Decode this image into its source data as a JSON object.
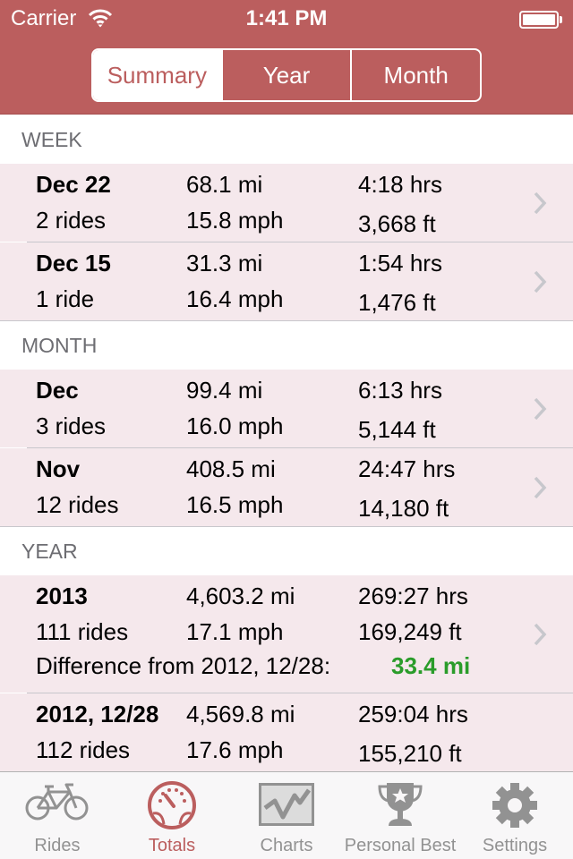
{
  "status_bar": {
    "carrier": "Carrier",
    "time": "1:41 PM",
    "wifi_icon": "wifi-icon",
    "battery_icon": "battery-icon"
  },
  "segments": [
    {
      "label": "Summary",
      "active": true
    },
    {
      "label": "Year",
      "active": false
    },
    {
      "label": "Month",
      "active": false
    }
  ],
  "sections": {
    "week": {
      "header": "WEEK",
      "rows": [
        {
          "title": "Dec 22",
          "rides": "2 rides",
          "distance": "68.1 mi",
          "speed": "15.8 mph",
          "duration": "4:18 hrs",
          "elevation": "3,668 ft"
        },
        {
          "title": "Dec 15",
          "rides": "1 ride",
          "distance": "31.3 mi",
          "speed": "16.4 mph",
          "duration": "1:54 hrs",
          "elevation": "1,476 ft"
        }
      ]
    },
    "month": {
      "header": "MONTH",
      "rows": [
        {
          "title": "Dec",
          "rides": "3 rides",
          "distance": "99.4 mi",
          "speed": "16.0 mph",
          "duration": "6:13 hrs",
          "elevation": "5,144 ft"
        },
        {
          "title": "Nov",
          "rides": "12 rides",
          "distance": "408.5 mi",
          "speed": "16.5 mph",
          "duration": "24:47 hrs",
          "elevation": "14,180 ft"
        }
      ]
    },
    "year": {
      "header": "YEAR",
      "rows": [
        {
          "title": "2013",
          "rides": "111 rides",
          "distance": "4,603.2 mi",
          "speed": "17.1 mph",
          "duration": "269:27 hrs",
          "elevation": "169,249 ft",
          "difference_label": "Difference from 2012, 12/28:",
          "difference_value": "33.4 mi"
        },
        {
          "title": "2012, 12/28",
          "rides": "112 rides",
          "distance": "4,569.8 mi",
          "speed": "17.6 mph",
          "duration": "259:04 hrs",
          "elevation": "155,210 ft"
        }
      ]
    }
  },
  "tabbar": {
    "tabs": [
      {
        "label": "Rides",
        "icon": "bicycle-icon",
        "active": false
      },
      {
        "label": "Totals",
        "icon": "speedometer-icon",
        "active": true
      },
      {
        "label": "Charts",
        "icon": "line-chart-icon",
        "active": false
      },
      {
        "label": "Personal Best",
        "icon": "trophy-icon",
        "active": false
      },
      {
        "label": "Settings",
        "icon": "gear-icon",
        "active": false
      }
    ]
  },
  "colors": {
    "accent": "#bb5e5e",
    "row_background": "#f5e8ec",
    "positive": "#2a9c2a",
    "inactive_tab": "#929292"
  }
}
